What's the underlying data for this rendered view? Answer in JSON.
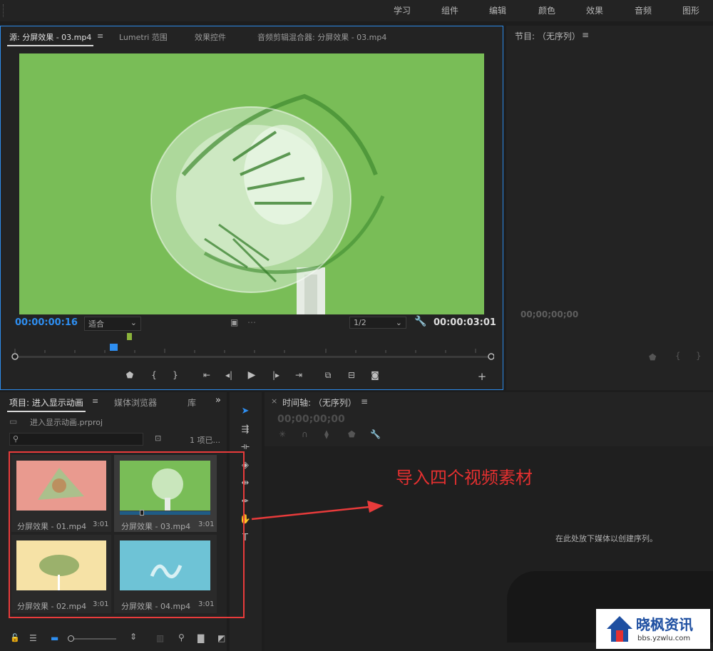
{
  "workspaces": [
    "学习",
    "组件",
    "编辑",
    "颜色",
    "效果",
    "音频",
    "图形"
  ],
  "source_panel": {
    "tabs": [
      "源: 分屏效果 - 03.mp4",
      "Lumetri 范围",
      "效果控件",
      "音频剪辑混合器: 分屏效果 - 03.mp4"
    ],
    "menu_icon": "hamburger-icon",
    "current_timecode": "00:00:00:16",
    "zoom_select": "适合",
    "resolution_select": "1/2",
    "duration_timecode": "00:00:03:01",
    "controls": [
      "marker-icon",
      "mark-in-icon",
      "mark-out-icon",
      "go-to-in-icon",
      "step-back-icon",
      "play-icon",
      "step-forward-icon",
      "go-to-out-icon",
      "insert-icon",
      "overwrite-icon",
      "export-frame-icon",
      "add-button-icon"
    ],
    "frame_bg_color": "#79bd57"
  },
  "program_panel": {
    "title": "节目: （无序列）",
    "timecode": "00;00;00;00"
  },
  "project_panel": {
    "tabs": [
      "项目: 进入显示动画",
      "媒体浏览器",
      "库"
    ],
    "project_file": "进入显示动画.prproj",
    "search_placeholder": "",
    "item_count": "1 项已...",
    "clips": [
      {
        "name": "分屏效果 - 01.mp4",
        "duration": "3:01",
        "thumb_color": "#e99a8f"
      },
      {
        "name": "分屏效果 - 03.mp4",
        "duration": "3:01",
        "thumb_color": "#79bd57"
      },
      {
        "name": "分屏效果 - 02.mp4",
        "duration": "3:01",
        "thumb_color": "#f6e2a6"
      },
      {
        "name": "分屏效果 - 04.mp4",
        "duration": "3:01",
        "thumb_color": "#6ec3d6"
      }
    ]
  },
  "tools": [
    "selection-tool-icon",
    "track-select-tool-icon",
    "ripple-edit-tool-icon",
    "razor-tool-icon",
    "slip-tool-icon",
    "pen-tool-icon",
    "hand-tool-icon",
    "type-tool-icon"
  ],
  "timeline_panel": {
    "title": "时间轴: （无序列）",
    "timecode": "00;00;00;00",
    "empty_hint": "在此处放下媒体以创建序列。"
  },
  "annotation": {
    "text": "导入四个视频素材",
    "color": "#e53030"
  },
  "watermark": {
    "name": "晓枫资讯",
    "url": "bbs.yzwlu.com"
  },
  "accent_color": "#2e8ef0"
}
